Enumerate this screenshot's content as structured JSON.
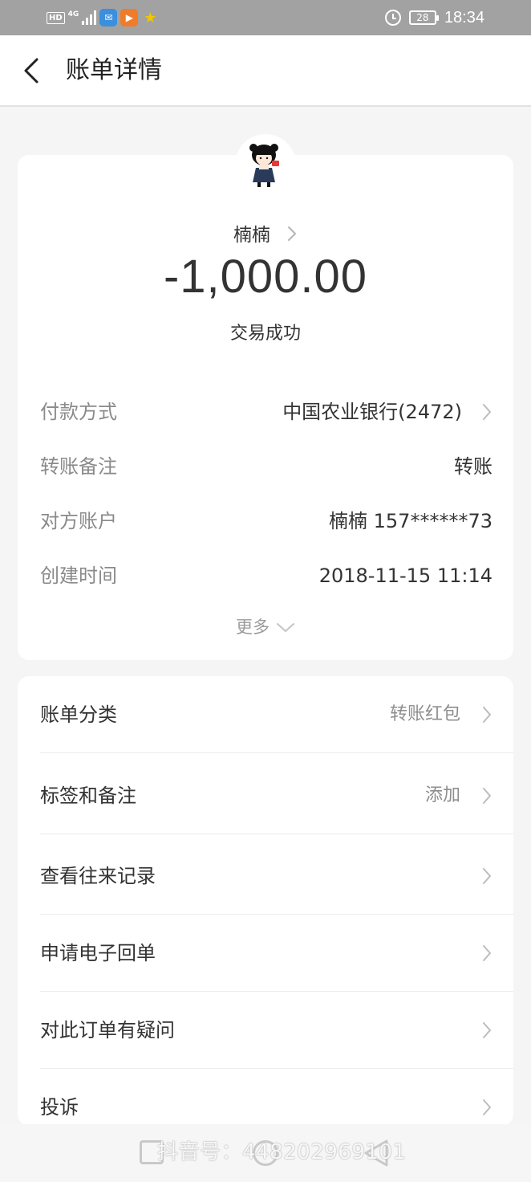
{
  "status_bar": {
    "time": "18:34",
    "battery": "28",
    "network_hd": "HD",
    "network_gen": "4G",
    "icons": [
      "hd-icon",
      "signal-icon",
      "app-badge-icon",
      "video-app-icon",
      "star-app-icon",
      "alarm-icon",
      "battery-icon"
    ]
  },
  "header": {
    "title": "账单详情",
    "back_icon": "chevron-left-icon"
  },
  "summary": {
    "payee": "楠楠",
    "amount": "-1,000.00",
    "status": "交易成功",
    "details": [
      {
        "label": "付款方式",
        "value": "中国农业银行(2472)",
        "has_arrow": true
      },
      {
        "label": "转账备注",
        "value": "转账",
        "has_arrow": false
      },
      {
        "label": "对方账户",
        "value": "楠楠 157******73",
        "has_arrow": false
      },
      {
        "label": "创建时间",
        "value": "2018-11-15 11:14",
        "has_arrow": false
      }
    ],
    "more_label": "更多"
  },
  "menu": {
    "items": [
      {
        "label": "账单分类",
        "value": "转账红包"
      },
      {
        "label": "标签和备注",
        "value": "添加"
      },
      {
        "label": "查看往来记录",
        "value": ""
      },
      {
        "label": "申请电子回单",
        "value": ""
      },
      {
        "label": "对此订单有疑问",
        "value": ""
      },
      {
        "label": "投诉",
        "value": ""
      }
    ]
  },
  "watermark": {
    "text": "抖音号：448202969101"
  },
  "colors": {
    "status_bar": "#a2a2a2",
    "page_bg": "#f5f5f5",
    "card_bg": "#ffffff",
    "label_gray": "#8a8a8a",
    "text_dark": "#333333"
  }
}
